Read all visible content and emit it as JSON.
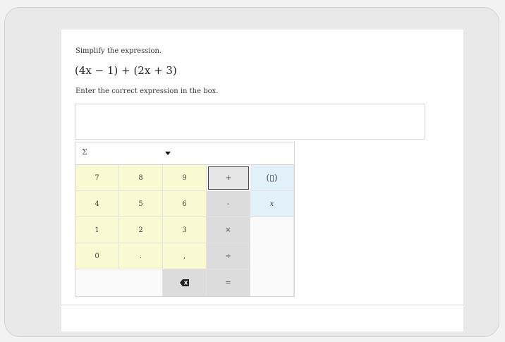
{
  "question": {
    "prompt": "Simplify the expression.",
    "expression": "(4x − 1) + (2x + 3)",
    "instruction": "Enter the correct expression in the box."
  },
  "answer": {
    "value": ""
  },
  "keypad": {
    "menu_label": "Σ",
    "keys": {
      "k7": "7",
      "k8": "8",
      "k9": "9",
      "plus": "+",
      "paren": "(▯)",
      "k4": "4",
      "k5": "5",
      "k6": "6",
      "minus": "-",
      "var": "x",
      "k1": "1",
      "k2": "2",
      "k3": "3",
      "times": "×",
      "k0": "0",
      "dot": ".",
      "comma": ",",
      "divide": "÷",
      "equals": "="
    }
  },
  "colors": {
    "number_key": "#fafad2",
    "operator_key": "#dcdcdc",
    "function_key": "#e2f0fa"
  }
}
